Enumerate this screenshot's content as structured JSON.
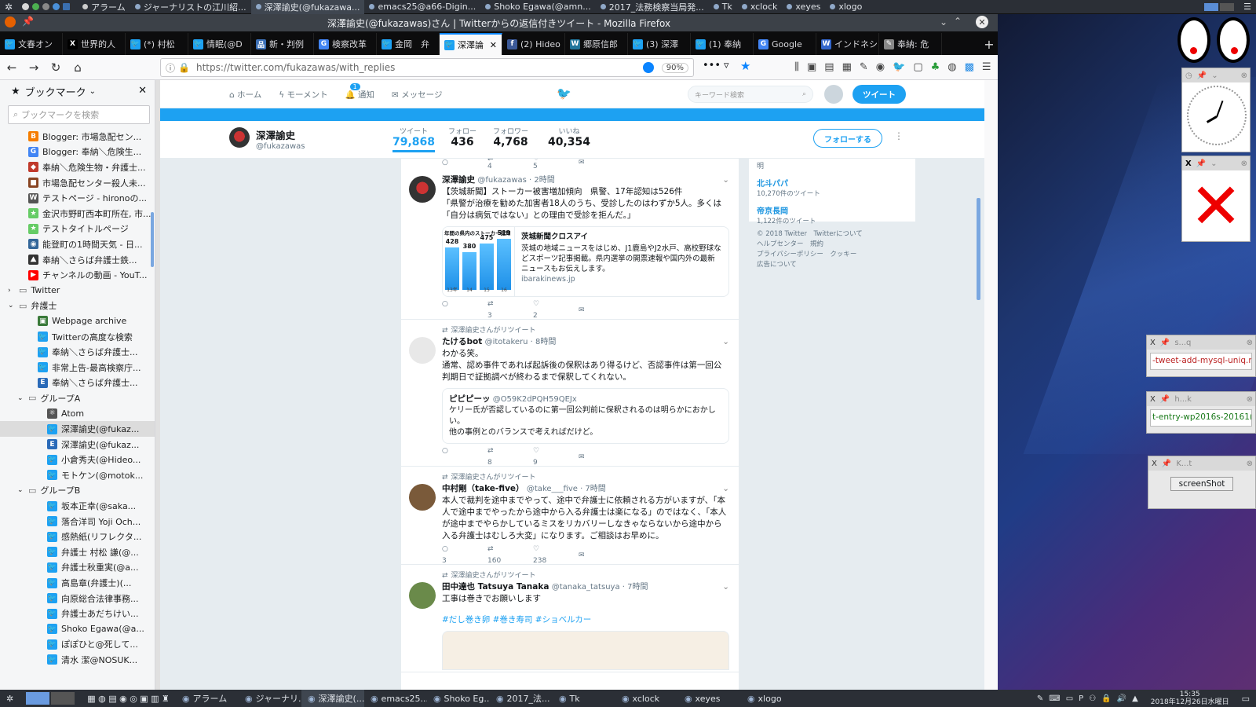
{
  "system_top": {
    "apps": [
      "アラーム",
      "ジャーナリストの江川紹...",
      "深澤諭史(@fukazawa...",
      "emacs25@a66-Digin...",
      "Shoko Egawa(@amn...",
      "2017_法務検察当局発...",
      "Tk",
      "xclock",
      "xeyes",
      "xlogo"
    ]
  },
  "window": {
    "title": "深澤諭史(@fukazawas)さん | Twitterからの返信付きツイート - Mozilla Firefox"
  },
  "tabs": [
    {
      "label": "文春オン",
      "color": "#1da1f2",
      "glyph": "🐦"
    },
    {
      "label": "世界的人",
      "color": "#000000",
      "glyph": "X"
    },
    {
      "label": "(*) 村松",
      "color": "#1da1f2",
      "glyph": "🐦"
    },
    {
      "label": "情眠(@D",
      "color": "#1da1f2",
      "glyph": "🐦"
    },
    {
      "label": "新・判例",
      "color": "#3b6fb6",
      "glyph": "品"
    },
    {
      "label": "検察改革",
      "color": "#4285f4",
      "glyph": "G"
    },
    {
      "label": "金岡　弁",
      "color": "#1da1f2",
      "glyph": "🐦"
    },
    {
      "label": "深澤論",
      "color": "#1da1f2",
      "glyph": "🐦"
    },
    {
      "label": "(2) Hideo",
      "color": "#3b5998",
      "glyph": "f"
    },
    {
      "label": "郷原信郎",
      "color": "#21759b",
      "glyph": "W"
    },
    {
      "label": "(3) 深澤",
      "color": "#1da1f2",
      "glyph": "🐦"
    },
    {
      "label": "(1) 奉納",
      "color": "#1da1f2",
      "glyph": "🐦"
    },
    {
      "label": "Google",
      "color": "#4285f4",
      "glyph": "G"
    },
    {
      "label": "インドネシ",
      "color": "#3366cc",
      "glyph": "W"
    },
    {
      "label": "奉納: 危",
      "color": "#888888",
      "glyph": "✎"
    }
  ],
  "navbar": {
    "url": "https://twitter.com/fukazawas/with_replies",
    "zoom": "90%"
  },
  "sidebar": {
    "title": "ブックマーク",
    "search_placeholder": "ブックマークを検索",
    "items": [
      {
        "label": "Blogger: 市場急配セン...",
        "indent": 3,
        "color": "#f57d00",
        "glyph": "B"
      },
      {
        "label": "Blogger: 奉納＼危険生...",
        "indent": 3,
        "color": "#4285f4",
        "glyph": "G"
      },
      {
        "label": "奉納＼危険生物・弁護士...",
        "indent": 3,
        "color": "#c0392b",
        "glyph": "◆"
      },
      {
        "label": "市場急配センター殺人未...",
        "indent": 3,
        "color": "#884422",
        "glyph": "■"
      },
      {
        "label": "テストページ - hironoの...",
        "indent": 3,
        "color": "#555555",
        "glyph": "W"
      },
      {
        "label": "金沢市野町西本町所在, 市...",
        "indent": 3,
        "color": "#66cc66",
        "glyph": "★"
      },
      {
        "label": "テストタイトルページ",
        "indent": 3,
        "color": "#66cc66",
        "glyph": "★"
      },
      {
        "label": "能登町の1時間天気 - 日...",
        "indent": 3,
        "color": "#336699",
        "glyph": "◉"
      },
      {
        "label": "奉納＼さらば弁護士鉄...",
        "indent": 3,
        "color": "#333333",
        "glyph": "⛰"
      },
      {
        "label": "チャンネルの動画 - YouT...",
        "indent": 3,
        "color": "#ff0000",
        "glyph": "▶"
      },
      {
        "label": "Twitter",
        "indent": 2,
        "folder": true,
        "open": false
      },
      {
        "label": "弁護士",
        "indent": 2,
        "folder": true,
        "open": true
      },
      {
        "label": "Webpage archive",
        "indent": 4,
        "color": "#3a7a3a",
        "glyph": "▣"
      },
      {
        "label": "Twitterの高度な検索",
        "indent": 4,
        "color": "#1da1f2",
        "glyph": "🐦"
      },
      {
        "label": "奉納＼さらば弁護士...",
        "indent": 4,
        "color": "#1da1f2",
        "glyph": "🐦"
      },
      {
        "label": "非常上告-最高検察庁...",
        "indent": 4,
        "color": "#1da1f2",
        "glyph": "🐦"
      },
      {
        "label": "奉納＼さらば弁護士...",
        "indent": 4,
        "color": "#2a6ab8",
        "glyph": "E"
      },
      {
        "label": "グループA",
        "indent": 3,
        "folder": true,
        "open": true
      },
      {
        "label": "Atom",
        "indent": 5,
        "color": "#555555",
        "glyph": "⚛"
      },
      {
        "label": "深澤諭史(@fukaz...",
        "indent": 5,
        "color": "#1da1f2",
        "glyph": "🐦",
        "selected": true
      },
      {
        "label": "深澤諭史(@fukaz...",
        "indent": 5,
        "color": "#2a6ab8",
        "glyph": "E"
      },
      {
        "label": "小倉秀夫(@Hideo...",
        "indent": 5,
        "color": "#1da1f2",
        "glyph": "🐦"
      },
      {
        "label": "モトケン(@motok...",
        "indent": 5,
        "color": "#1da1f2",
        "glyph": "🐦"
      },
      {
        "label": "グループB",
        "indent": 3,
        "folder": true,
        "open": true
      },
      {
        "label": "坂本正幸(@saka...",
        "indent": 5,
        "color": "#1da1f2",
        "glyph": "🐦"
      },
      {
        "label": "落合洋司 Yoji Och...",
        "indent": 5,
        "color": "#1da1f2",
        "glyph": "🐦"
      },
      {
        "label": "感熱紙(リフレクタ...",
        "indent": 5,
        "color": "#1da1f2",
        "glyph": "🐦"
      },
      {
        "label": "弁護士 村松 謙(@...",
        "indent": 5,
        "color": "#1da1f2",
        "glyph": "🐦"
      },
      {
        "label": "弁護士秋重実(@a...",
        "indent": 5,
        "color": "#1da1f2",
        "glyph": "🐦"
      },
      {
        "label": "高島章(弁護士)(...",
        "indent": 5,
        "color": "#1da1f2",
        "glyph": "🐦"
      },
      {
        "label": "向原総合法律事務...",
        "indent": 5,
        "color": "#1da1f2",
        "glyph": "🐦"
      },
      {
        "label": "弁護士あだちけい...",
        "indent": 5,
        "color": "#1da1f2",
        "glyph": "🐦"
      },
      {
        "label": "Shoko Egawa(@a...",
        "indent": 5,
        "color": "#1da1f2",
        "glyph": "🐦"
      },
      {
        "label": "ぽぽひと@死して...",
        "indent": 5,
        "color": "#1da1f2",
        "glyph": "🐦"
      },
      {
        "label": "清水 潔@NOSUK...",
        "indent": 5,
        "color": "#1da1f2",
        "glyph": "🐦"
      }
    ]
  },
  "twitter_nav": {
    "home": "ホーム",
    "moments": "モーメント",
    "notifications": "通知",
    "notif_count": "1",
    "messages": "メッセージ",
    "search_placeholder": "キーワード検索",
    "tweet_button": "ツイート"
  },
  "profile": {
    "name": "深澤諭史",
    "handle": "@fukazawas",
    "stats": [
      {
        "label": "ツイート",
        "value": "79,868"
      },
      {
        "label": "フォロー",
        "value": "436"
      },
      {
        "label": "フォロワー",
        "value": "4,768"
      },
      {
        "label": "いいね",
        "value": "40,354"
      }
    ],
    "follow_button": "フォローする"
  },
  "top_actions": {
    "retweets": "4",
    "likes": "5"
  },
  "tweets": [
    {
      "name": "深澤諭史",
      "handle": "@fukazawas · 2時間",
      "text": "【茨城新聞】ストーカー被害増加傾向　県警、17年認知は526件\n「県警が治療を勧めた加害者18人のうち、受診したのはわずか5人。多くは「自分は病気ではない」との理由で受診を拒んだ。」",
      "card": {
        "title": "茨城新聞クロスアイ",
        "desc": "茨城の地域ニュースをはじめ、J1鹿島やJ2水戸、高校野球などスポーツ記事掲載。県内選挙の開票速報や国内外の最新ニュースもお伝えします。",
        "domain": "ibarakinews.jp",
        "chart_title": "年間の県内のストーカー認知",
        "bar_labels": [
          "428",
          "380",
          "475",
          "519"
        ],
        "axis_labels": [
          "13年",
          "14",
          "15",
          "16"
        ]
      },
      "replies": "",
      "retweets": "3",
      "likes": "2"
    },
    {
      "rt_note": "深澤諭史さんがリツイート",
      "name": "たけるbot",
      "handle": "@itotakeru · 8時間",
      "text": "わかる笑。\n通常、認め事件であれば起訴後の保釈はあり得るけど、否認事件は第一回公判期日で証拠調べが終わるまで保釈してくれない。",
      "quote": {
        "name": "ピピピーッ",
        "handle": "@O59K2dPQH59QEJx",
        "text": "ケリー氏が否認しているのに第一回公判前に保釈されるのは明らかにおかしい。\n他の事例とのバランスで考えればだけど。"
      },
      "replies": "",
      "retweets": "8",
      "likes": "9"
    },
    {
      "rt_note": "深澤諭史さんがリツイート",
      "name": "中村剛（take-five）",
      "handle": "@take___five · 7時間",
      "text": "本人で裁判を途中までやって、途中で弁護士に依頼される方がいますが、「本人で途中までやったから途中から入る弁護士は楽になる」のではなく、「本人が途中までやらかしているミスをリカバリーしなきゃならないから途中から入る弁護士はむしろ大変」になります。ご相談はお早めに。",
      "replies": "3",
      "retweets": "160",
      "likes": "238"
    },
    {
      "rt_note": "深澤諭史さんがリツイート",
      "name": "田中達也 Tatsuya Tanaka",
      "handle": "@tanaka_tatsuya · 7時間",
      "text": "工事は巻きでお願いします",
      "hashtags": "#だし巻き卵 #巻き寿司 #ショベルカー"
    }
  ],
  "rightcol": {
    "truncated": "明",
    "who_to_follow": [
      {
        "name": "北斗パパ",
        "sub": "10,270件のツイート"
      },
      {
        "name": "帝京長岡",
        "sub": "1,122件のツイート"
      }
    ],
    "footer": "© 2018 Twitter　Twitterについて\nヘルプセンター　規約\nプライバシーポリシー　クッキー\n広告について"
  },
  "desktop": {
    "win1_title": "s...q",
    "win1_text": "-tweet-add-mysql-uniq.r",
    "win2_title": "h...k",
    "win2_text": "t-entry-wp2016s-20161(",
    "win3_title": "K...t",
    "win3_button": "screenShot"
  },
  "bottom": {
    "tasks": [
      "アラーム",
      "ジャーナリ...",
      "深澤諭史(...",
      "emacs25...",
      "Shoko Eg...",
      "2017_法...",
      "Tk",
      "xclock",
      "xeyes",
      "xlogo"
    ],
    "active_index": 2,
    "time": "15:35",
    "date": "2018年12月26日水曜日"
  }
}
